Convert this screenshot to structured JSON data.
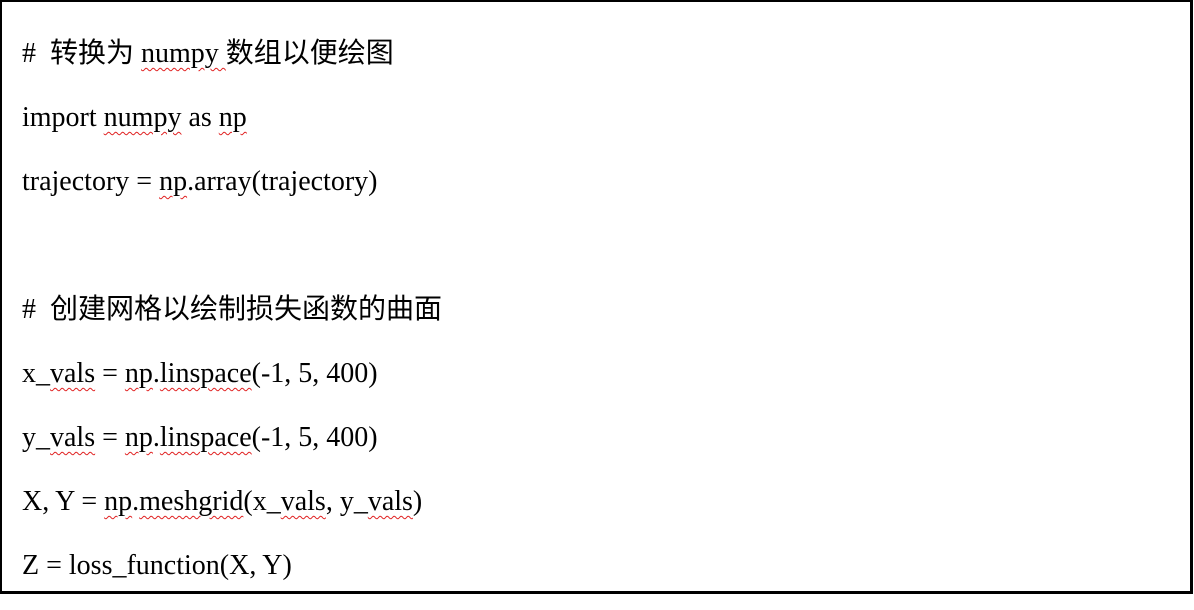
{
  "code_lines": [
    [
      {
        "t": "#  转换为 "
      },
      {
        "t": "numpy ",
        "s": true
      },
      {
        "t": "数组以便绘图"
      }
    ],
    [
      {
        "t": "import "
      },
      {
        "t": "numpy",
        "s": true
      },
      {
        "t": " as "
      },
      {
        "t": "np",
        "s": true
      }
    ],
    [
      {
        "t": "trajectory = "
      },
      {
        "t": "np",
        "s": true
      },
      {
        "t": ".array(trajectory)"
      }
    ],
    [
      {
        "t": ""
      }
    ],
    [
      {
        "t": "#  创建网格以绘制损失函数的曲面"
      }
    ],
    [
      {
        "t": "x_"
      },
      {
        "t": "vals",
        "s": true
      },
      {
        "t": " = "
      },
      {
        "t": "np",
        "s": true
      },
      {
        "t": "."
      },
      {
        "t": "linspace",
        "s": true
      },
      {
        "t": "(-1, 5, 400)"
      }
    ],
    [
      {
        "t": "y_"
      },
      {
        "t": "vals",
        "s": true
      },
      {
        "t": " = "
      },
      {
        "t": "np",
        "s": true
      },
      {
        "t": "."
      },
      {
        "t": "linspace",
        "s": true
      },
      {
        "t": "(-1, 5, 400)"
      }
    ],
    [
      {
        "t": "X, Y = "
      },
      {
        "t": "np",
        "s": true
      },
      {
        "t": "."
      },
      {
        "t": "meshgrid",
        "s": true
      },
      {
        "t": "(x_"
      },
      {
        "t": "vals",
        "s": true
      },
      {
        "t": ", y_"
      },
      {
        "t": "vals",
        "s": true
      },
      {
        "t": ")"
      }
    ],
    [
      {
        "t": "Z = loss_function(X, Y)"
      }
    ]
  ]
}
